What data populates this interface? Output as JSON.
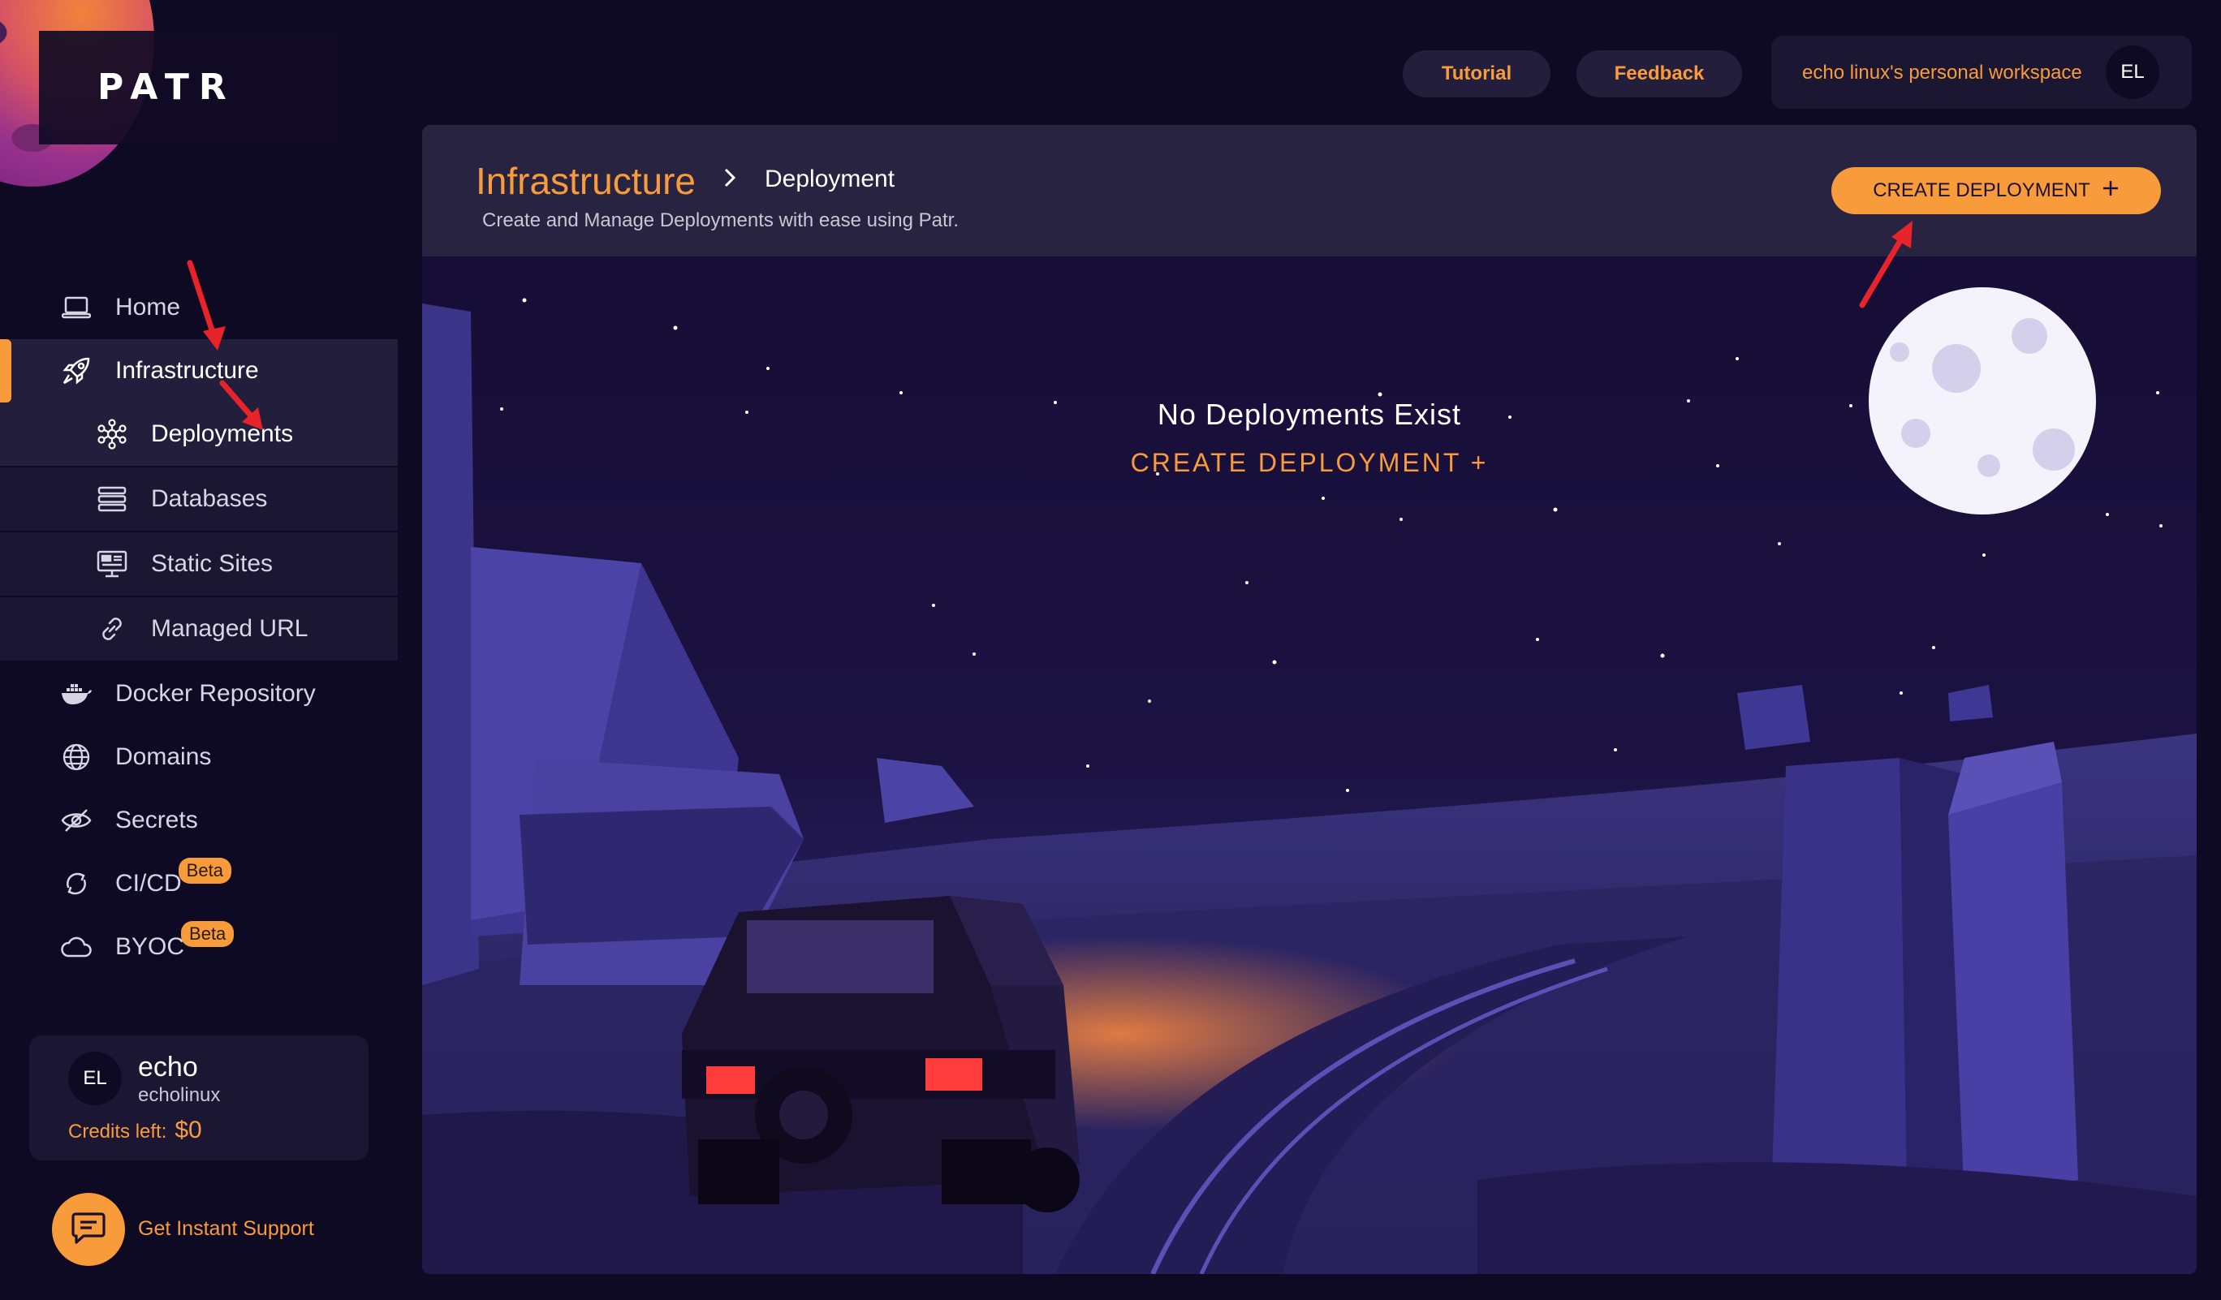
{
  "brand": {
    "logo_text": "PATR",
    "accent": "#f89b3a"
  },
  "topbar": {
    "tutorial_label": "Tutorial",
    "feedback_label": "Feedback",
    "workspace_label": "echo linux's personal workspace",
    "workspace_avatar": "EL"
  },
  "sidebar": {
    "items": [
      {
        "label": "Home",
        "icon": "laptop-icon"
      },
      {
        "label": "Infrastructure",
        "icon": "rocket-icon"
      },
      {
        "label": "Docker Repository",
        "icon": "docker-icon"
      },
      {
        "label": "Domains",
        "icon": "globe-icon"
      },
      {
        "label": "Secrets",
        "icon": "eye-slash-icon"
      },
      {
        "label": "CI/CD",
        "icon": "cycle-icon",
        "badge": "Beta"
      },
      {
        "label": "BYOC",
        "icon": "cloud-icon",
        "badge": "Beta"
      }
    ],
    "sub_items": [
      {
        "label": "Deployments",
        "icon": "cluster-icon"
      },
      {
        "label": "Databases",
        "icon": "database-icon"
      },
      {
        "label": "Static Sites",
        "icon": "monitor-icon"
      },
      {
        "label": "Managed URL",
        "icon": "link-icon"
      }
    ]
  },
  "user": {
    "avatar": "EL",
    "name": "echo",
    "handle": "echolinux",
    "credits_label": "Credits left:",
    "credits_value": "$0"
  },
  "support": {
    "label": "Get Instant Support",
    "icon": "chat-icon"
  },
  "header": {
    "breadcrumb_root": "Infrastructure",
    "breadcrumb_leaf": "Deployment",
    "subtitle": "Create and Manage Deployments with ease using Patr.",
    "create_label": "CREATE DEPLOYMENT"
  },
  "empty_state": {
    "title": "No Deployments Exist",
    "cta": "CREATE DEPLOYMENT +"
  }
}
